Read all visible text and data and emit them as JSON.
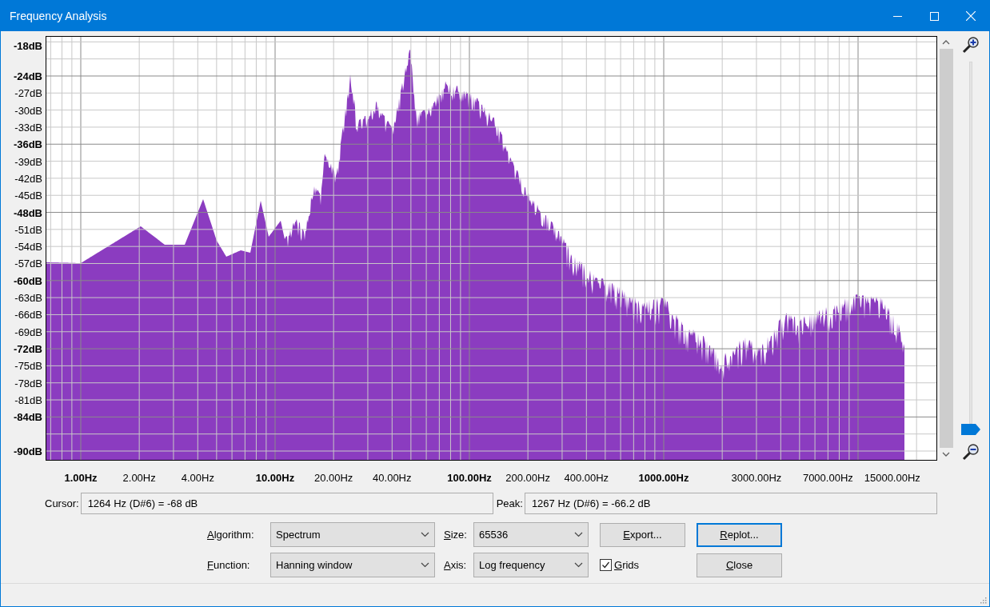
{
  "window": {
    "title": "Frequency Analysis"
  },
  "plot": {
    "y_labels": [
      {
        "text": "-18dB",
        "major": true
      },
      {
        "text": "-24dB",
        "major": true
      },
      {
        "text": "-27dB",
        "major": false
      },
      {
        "text": "-30dB",
        "major": false
      },
      {
        "text": "-33dB",
        "major": false
      },
      {
        "text": "-36dB",
        "major": true
      },
      {
        "text": "-39dB",
        "major": false
      },
      {
        "text": "-42dB",
        "major": false
      },
      {
        "text": "-45dB",
        "major": false
      },
      {
        "text": "-48dB",
        "major": true
      },
      {
        "text": "-51dB",
        "major": false
      },
      {
        "text": "-54dB",
        "major": false
      },
      {
        "text": "-57dB",
        "major": false
      },
      {
        "text": "-60dB",
        "major": true
      },
      {
        "text": "-63dB",
        "major": false
      },
      {
        "text": "-66dB",
        "major": false
      },
      {
        "text": "-69dB",
        "major": false
      },
      {
        "text": "-72dB",
        "major": true
      },
      {
        "text": "-75dB",
        "major": false
      },
      {
        "text": "-78dB",
        "major": false
      },
      {
        "text": "-81dB",
        "major": false
      },
      {
        "text": "-84dB",
        "major": true
      },
      {
        "text": "-90dB",
        "major": true
      }
    ],
    "x_labels": [
      {
        "text": "1.00Hz",
        "major": true
      },
      {
        "text": "2.00Hz",
        "major": false
      },
      {
        "text": "4.00Hz",
        "major": false
      },
      {
        "text": "10.00Hz",
        "major": true
      },
      {
        "text": "20.00Hz",
        "major": false
      },
      {
        "text": "40.00Hz",
        "major": false
      },
      {
        "text": "100.00Hz",
        "major": true
      },
      {
        "text": "200.00Hz",
        "major": false
      },
      {
        "text": "400.00Hz",
        "major": false
      },
      {
        "text": "1000.00Hz",
        "major": true
      },
      {
        "text": "3000.00Hz",
        "major": false
      },
      {
        "text": "7000.00Hz",
        "major": false
      },
      {
        "text": "15000.00Hz",
        "major": false
      }
    ]
  },
  "zoom": {
    "level": 0
  },
  "readouts": [
    {
      "label": "Cursor:",
      "value": "1264 Hz (D#6) = -68 dB"
    },
    {
      "label": "Peak:",
      "value": "1267 Hz (D#6) = -66.2 dB"
    }
  ],
  "controls": {
    "algorithm": {
      "label": "Algorithm:",
      "value": "Spectrum"
    },
    "size": {
      "label": "Size:",
      "value": "65536"
    },
    "function": {
      "label": "Function:",
      "value": "Hanning window"
    },
    "axis": {
      "label": "Axis:",
      "value": "Log frequency"
    },
    "grids": {
      "label": "Grids",
      "checked": true
    }
  },
  "buttons": [
    {
      "label": "Export...",
      "focused": false
    },
    {
      "label": "Replot...",
      "focused": true
    },
    {
      "label": "Close",
      "focused": false
    }
  ]
}
